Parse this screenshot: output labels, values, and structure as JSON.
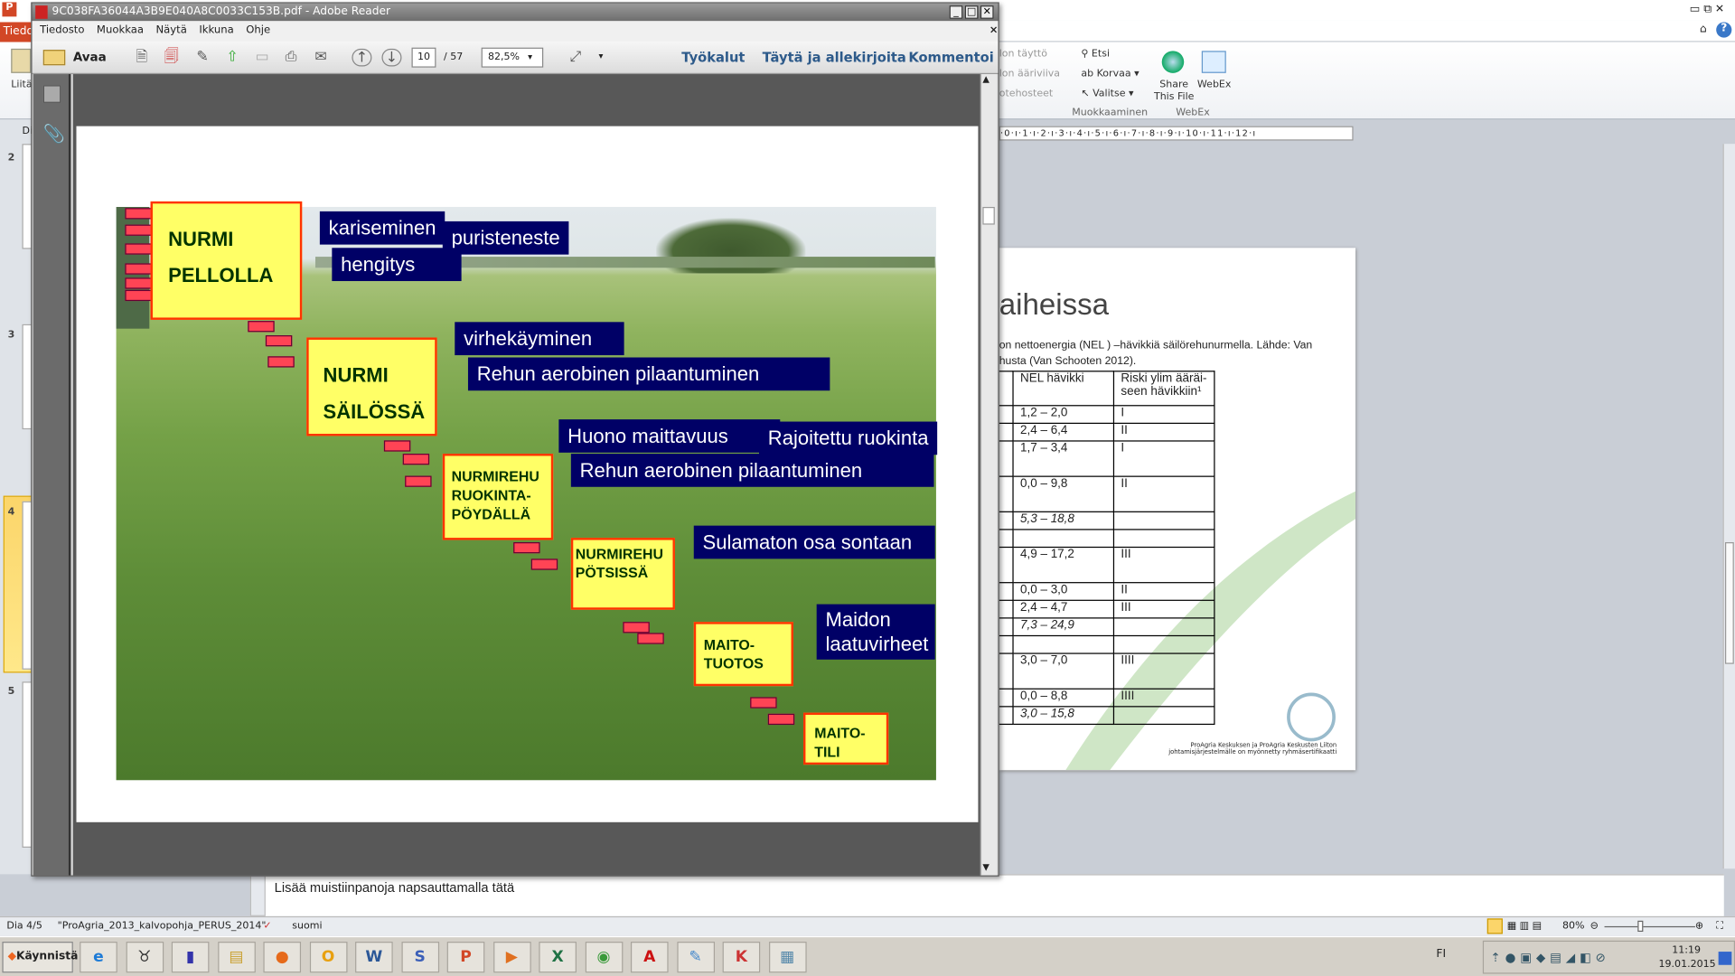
{
  "powerpoint": {
    "file_tab": "Tiedo",
    "paste_label": "Liitä",
    "ribbon": {
      "fill": "lon täyttö",
      "outline": "lon ääriviiva",
      "effects": "otehosteet",
      "find": "Etsi",
      "replace": "Korvaa",
      "select": "Valitse",
      "group_editing": "Muokkaaminen",
      "share": "Share This File",
      "webex": "WebEx",
      "group_webex": "WebEx"
    },
    "ruler": "·0·ı·1·ı·2·ı·3·ı·4·ı·5·ı·6·ı·7·ı·8·ı·9·ı·10·ı·11·ı·12·ı",
    "thumbs_header": "Di",
    "slide_numbers": [
      "2",
      "3",
      "4",
      "5"
    ],
    "selected_slide": "4",
    "slide": {
      "title": "aiheissa",
      "caption": "on nettoenergia (NEL ) –hävikkiä säilörehunurmella. Lähde: Van husta (Van Schooten 2012).",
      "table_headers": [
        "NEL hävikki",
        "Riski ylim ääräi-seen hävikkiin¹"
      ],
      "table_rows": [
        [
          "1,2 – 2,0",
          "I"
        ],
        [
          "2,4 – 6,4",
          "II"
        ],
        [
          "1,7 – 3,4",
          "I"
        ],
        [
          "0,0 – 9,8",
          "II"
        ],
        [
          "5,3 – 18,8",
          ""
        ],
        [
          "",
          ""
        ],
        [
          "4,9 – 17,2",
          "III"
        ],
        [
          "0,0 – 3,0",
          "II"
        ],
        [
          "2,4 – 4,7",
          "III"
        ],
        [
          "7,3 – 24,9",
          ""
        ],
        [
          "",
          ""
        ],
        [
          "3,0 – 7,0",
          "IIII"
        ],
        [
          "0,0 – 8,8",
          "IIII"
        ],
        [
          "3,0 – 15,8",
          ""
        ]
      ],
      "footer": "ProAgria Keskuksen ja ProAgria Keskusten Liiton johtamisjärjestelmälle on myönnetty ryhmäsertifikaatti"
    },
    "notes_placeholder": "Lisää muistiinpanoja napsauttamalla tätä",
    "status": {
      "slide": "Dia 4/5",
      "theme": "\"ProAgria_2013_kalvopohja_PERUS_2014\"",
      "language": "suomi",
      "zoom": "80%"
    }
  },
  "acrobat": {
    "title": "9C038FA36044A3B9E040A8C0033C153B.pdf - Adobe Reader",
    "menu": [
      "Tiedosto",
      "Muokkaa",
      "Näytä",
      "Ikkuna",
      "Ohje"
    ],
    "open_label": "Avaa",
    "page_current": "10",
    "page_total": "/ 57",
    "zoom": "82,5%",
    "links": [
      "Työkalut",
      "Täytä ja allekirjoita",
      "Kommentoi"
    ],
    "slide": {
      "stages": [
        "NURMI PELLOLLA",
        "NURMI SÄILÖSSÄ",
        "NURMIREHU RUOKINTA-PÖYDÄLLÄ",
        "NURMIREHU PÖTSISSÄ",
        "MAITO-TUOTOS",
        "MAITO-TILI"
      ],
      "losses": [
        "kariseminen",
        "puristeneste",
        "hengitys",
        "virhekäyminen",
        "Rehun aerobinen pilaantuminen",
        "Huono maittavuus",
        "Rajoitettu ruokinta",
        "Rehun aerobinen pilaantuminen",
        "Sulamaton osa sontaan",
        "Maidon laatuvirheet"
      ],
      "colors": {
        "stage_fill": "#ffff66",
        "stage_border": "#ff3300",
        "loss_fill": "#000066"
      }
    }
  },
  "taskbar": {
    "start": "Käynnistä",
    "apps": [
      "internet-explorer",
      "cow-app",
      "chart-app",
      "file-explorer",
      "firefox",
      "outlook",
      "word",
      "skype-s",
      "powerpoint",
      "media-player",
      "excel",
      "chrome",
      "acrobat",
      "paint",
      "red-app",
      "calculator"
    ],
    "lang": "FI",
    "time": "11:19",
    "date": "19.01.2015"
  }
}
